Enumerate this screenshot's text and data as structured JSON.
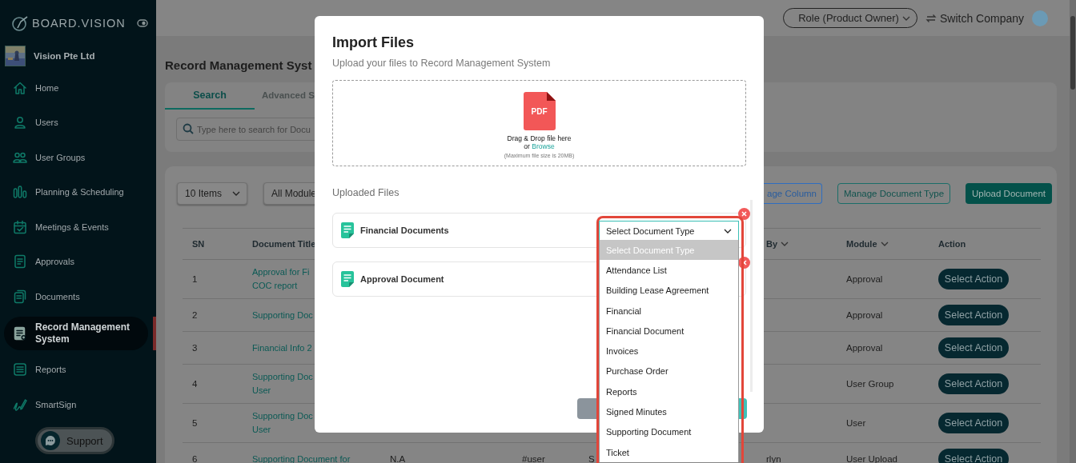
{
  "sidebar": {
    "brand": "BOARD.VISION",
    "company": "Vision Pte Ltd",
    "items": [
      {
        "label": "Home",
        "selected": false
      },
      {
        "label": "Users",
        "selected": false
      },
      {
        "label": "User Groups",
        "selected": false
      },
      {
        "label": "Planning & Scheduling",
        "selected": false
      },
      {
        "label": "Meetings & Events",
        "selected": false
      },
      {
        "label": "Approvals",
        "selected": false
      },
      {
        "label": "Documents",
        "selected": false
      },
      {
        "label": "Record Management System",
        "selected": true
      },
      {
        "label": "Reports",
        "selected": false
      },
      {
        "label": "SmartSign",
        "selected": false
      }
    ],
    "support": "Support"
  },
  "header": {
    "role": "Role (Product Owner)",
    "switch_company": "Switch Company"
  },
  "page": {
    "title": "Record Management Syst",
    "tabs": [
      {
        "label": "Search",
        "selected": true
      },
      {
        "label": "Advanced S",
        "selected": false
      }
    ],
    "search_placeholder": "Type here to search for Docu"
  },
  "toolbar": {
    "page_size": "10 Items",
    "module": "All Module",
    "buttons": [
      {
        "label": "age Column",
        "kind": "outline-blue"
      },
      {
        "label": "Manage Document Type",
        "kind": "outline-teal"
      },
      {
        "label": "Upload Document",
        "kind": "solid"
      }
    ]
  },
  "table": {
    "columns": {
      "sn": "SN",
      "title": "Document Title",
      "column_6": "By",
      "module": "Module",
      "action": "Action"
    },
    "rows": [
      {
        "sn": "1",
        "title": [
          "Approval for Fi",
          "COC report"
        ],
        "module": "Approval",
        "action": "Select Action"
      },
      {
        "sn": "2",
        "title": [
          "Supporting Doc"
        ],
        "module": "Approval",
        "action": "Select Action"
      },
      {
        "sn": "3",
        "title": [
          "Financial Info 2"
        ],
        "module": "Approval",
        "action": "Select Action"
      },
      {
        "sn": "4",
        "title": [
          "Supporting Doc",
          "User"
        ],
        "module": "User Group",
        "action": "Select Action"
      },
      {
        "sn": "5",
        "title": [
          "Supporting Doc",
          "User"
        ],
        "module": "User",
        "action": "Select Action"
      },
      {
        "sn": "6",
        "title": [
          "Supporting Document for"
        ],
        "column_3": "N.A",
        "column_4": "#user",
        "column_5": "S",
        "column_6": "rlyn",
        "module": "User Upload",
        "action": "Select Action"
      }
    ]
  },
  "modal": {
    "title": "Import Files",
    "subtitle": "Upload your files to Record Management System",
    "dropzone": {
      "badge": "PDF",
      "line_1": "Drag & Drop file here",
      "browse_prefix": "or",
      "browse_link": "Browse",
      "note": "(Maximum file size is 20MB)"
    },
    "uploaded_label": "Uploaded Files",
    "files": [
      {
        "name": "Financial Documents",
        "select": "Select Document Type"
      },
      {
        "name": "Approval Document"
      }
    ],
    "dropdown": [
      {
        "label": "Select Document Type",
        "selected": true
      },
      {
        "label": "Attendance List",
        "selected": false
      },
      {
        "label": "Building Lease Agreement",
        "selected": false
      },
      {
        "label": "Financial",
        "selected": false
      },
      {
        "label": "Financial Document",
        "selected": false
      },
      {
        "label": "Invoices",
        "selected": false
      },
      {
        "label": "Purchase Order",
        "selected": false
      },
      {
        "label": "Reports",
        "selected": false
      },
      {
        "label": "Signed Minutes",
        "selected": false
      },
      {
        "label": "Supporting Document",
        "selected": false
      },
      {
        "label": "Ticket",
        "selected": false
      }
    ]
  }
}
